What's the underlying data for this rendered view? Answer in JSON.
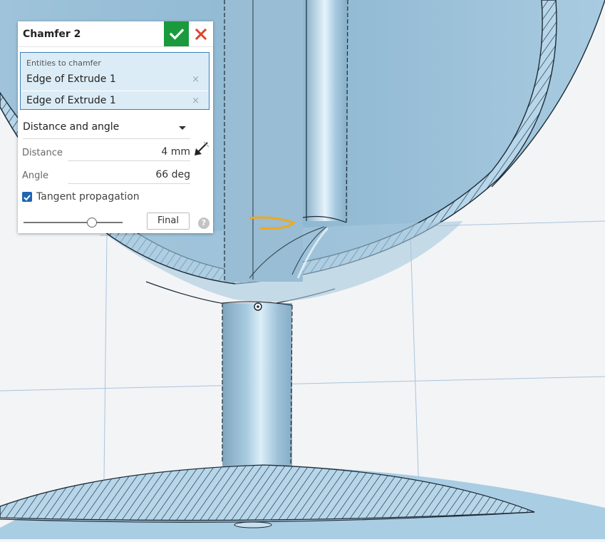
{
  "feature": {
    "title": "Chamfer 2",
    "accept_icon": "checkmark-icon",
    "cancel_icon": "close-icon"
  },
  "entities": {
    "label": "Entities to chamfer",
    "items": [
      {
        "label": "Edge of Extrude 1",
        "remove_glyph": "×"
      },
      {
        "label": "Edge of Extrude 1",
        "remove_glyph": "×"
      }
    ]
  },
  "method": {
    "selected": "Distance and angle"
  },
  "distance": {
    "label": "Distance",
    "value": "4 mm"
  },
  "angle": {
    "label": "Angle",
    "value": "66 deg"
  },
  "tangent_propagation": {
    "label": "Tangent propagation",
    "checked": true
  },
  "rollback": {
    "final_label": "Final"
  },
  "help": {
    "glyph": "?"
  },
  "colors": {
    "accept": "#1a9a3c",
    "cancel": "#d9472b",
    "selection_highlight": "#f0a81e",
    "model_fill": "#a9cde3",
    "panel_border": "#3c7fb8"
  }
}
